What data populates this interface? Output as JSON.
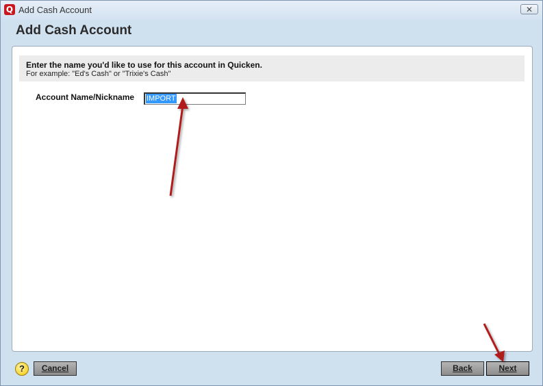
{
  "window": {
    "title": "Add Cash Account",
    "app_icon_letter": "Q",
    "close_symbol": "✕"
  },
  "header": {
    "title": "Add Cash Account"
  },
  "info": {
    "title": "Enter the name you'd like to use for this account in Quicken.",
    "example": "For example: \"Ed's Cash\" or \"Trixie's Cash\""
  },
  "form": {
    "account_name_label": "Account Name/Nickname",
    "account_name_value": "IMPORT"
  },
  "footer": {
    "help_symbol": "?",
    "cancel_label": "Cancel",
    "back_label": "Back",
    "next_label": "Next"
  },
  "colors": {
    "annotation_arrow": "#b01c1c",
    "selection": "#3399ff"
  }
}
